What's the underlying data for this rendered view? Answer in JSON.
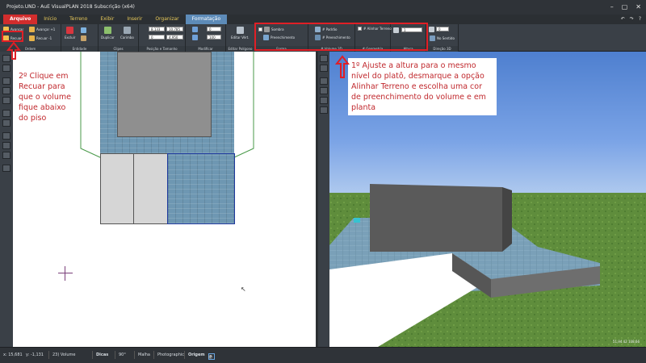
{
  "window": {
    "title": "Projeto.UND - AuE VisualPLAN 2018 Subscrição (x64)"
  },
  "menu": {
    "file": "Arquivo",
    "tabs": [
      "Início",
      "Terreno",
      "Exibir",
      "Inserir",
      "Organizar"
    ],
    "active": "Formatação"
  },
  "ribbon": {
    "ordem": {
      "label": "Ordem",
      "avancar": "Avançar",
      "recuar": "Recuar",
      "avancar1": "Avançar +1",
      "recuar1": "Recuar -1"
    },
    "entidade": {
      "label": "Entidade",
      "excluir": "Excluir"
    },
    "clipboard": {
      "label": "Clipes",
      "duplicar": "Duplicar",
      "carimbo": "Carimbo"
    },
    "posicao": {
      "label": "Posição e Tamanho",
      "x": "8,133",
      "y": "0",
      "w": "10,785",
      "h": "4,950"
    },
    "modificar": {
      "label": "Modificar",
      "v1": "0",
      "v2": "100"
    },
    "editar": {
      "label": "Editar Polígono",
      "btn": "Editar Vért."
    },
    "forma": {
      "label": "Forma",
      "sombra": "Sombra",
      "preenchimento": "Preenchimento"
    },
    "volume3d": {
      "label": "# Volume 3D",
      "padrao": "# Padrão",
      "preenchimento": "# Preenchimento"
    },
    "geometria": {
      "label": "# Geometria",
      "alinhar": "# Alinhar Terreno"
    },
    "altura": {
      "label": "Altura",
      "value": "1"
    },
    "direcao": {
      "label": "Direção 3D",
      "value": "0",
      "btn": "No Sentido"
    }
  },
  "annotations": {
    "left": "2º Clique em Recuar para que o volume fique abaixo do piso",
    "right": "1º Ajuste a altura para o mesmo nível do platô, desmarque a opção Alinhar Terreno e escolha uma cor de preenchimento do volume e em planta"
  },
  "view3d": {
    "corner": "51,94   42   108,66"
  },
  "status": {
    "x": "x: 15,681",
    "y": "y: -1,131",
    "sel": "23) Volume",
    "dicas": "Dicas",
    "angle": "90°",
    "malha": "Malha",
    "photo": "Photographic",
    "origem": "Origem"
  },
  "colors": {
    "accent_red": "#e01f26",
    "tile": "#6e97b2",
    "selection": "#1f3a9e"
  }
}
